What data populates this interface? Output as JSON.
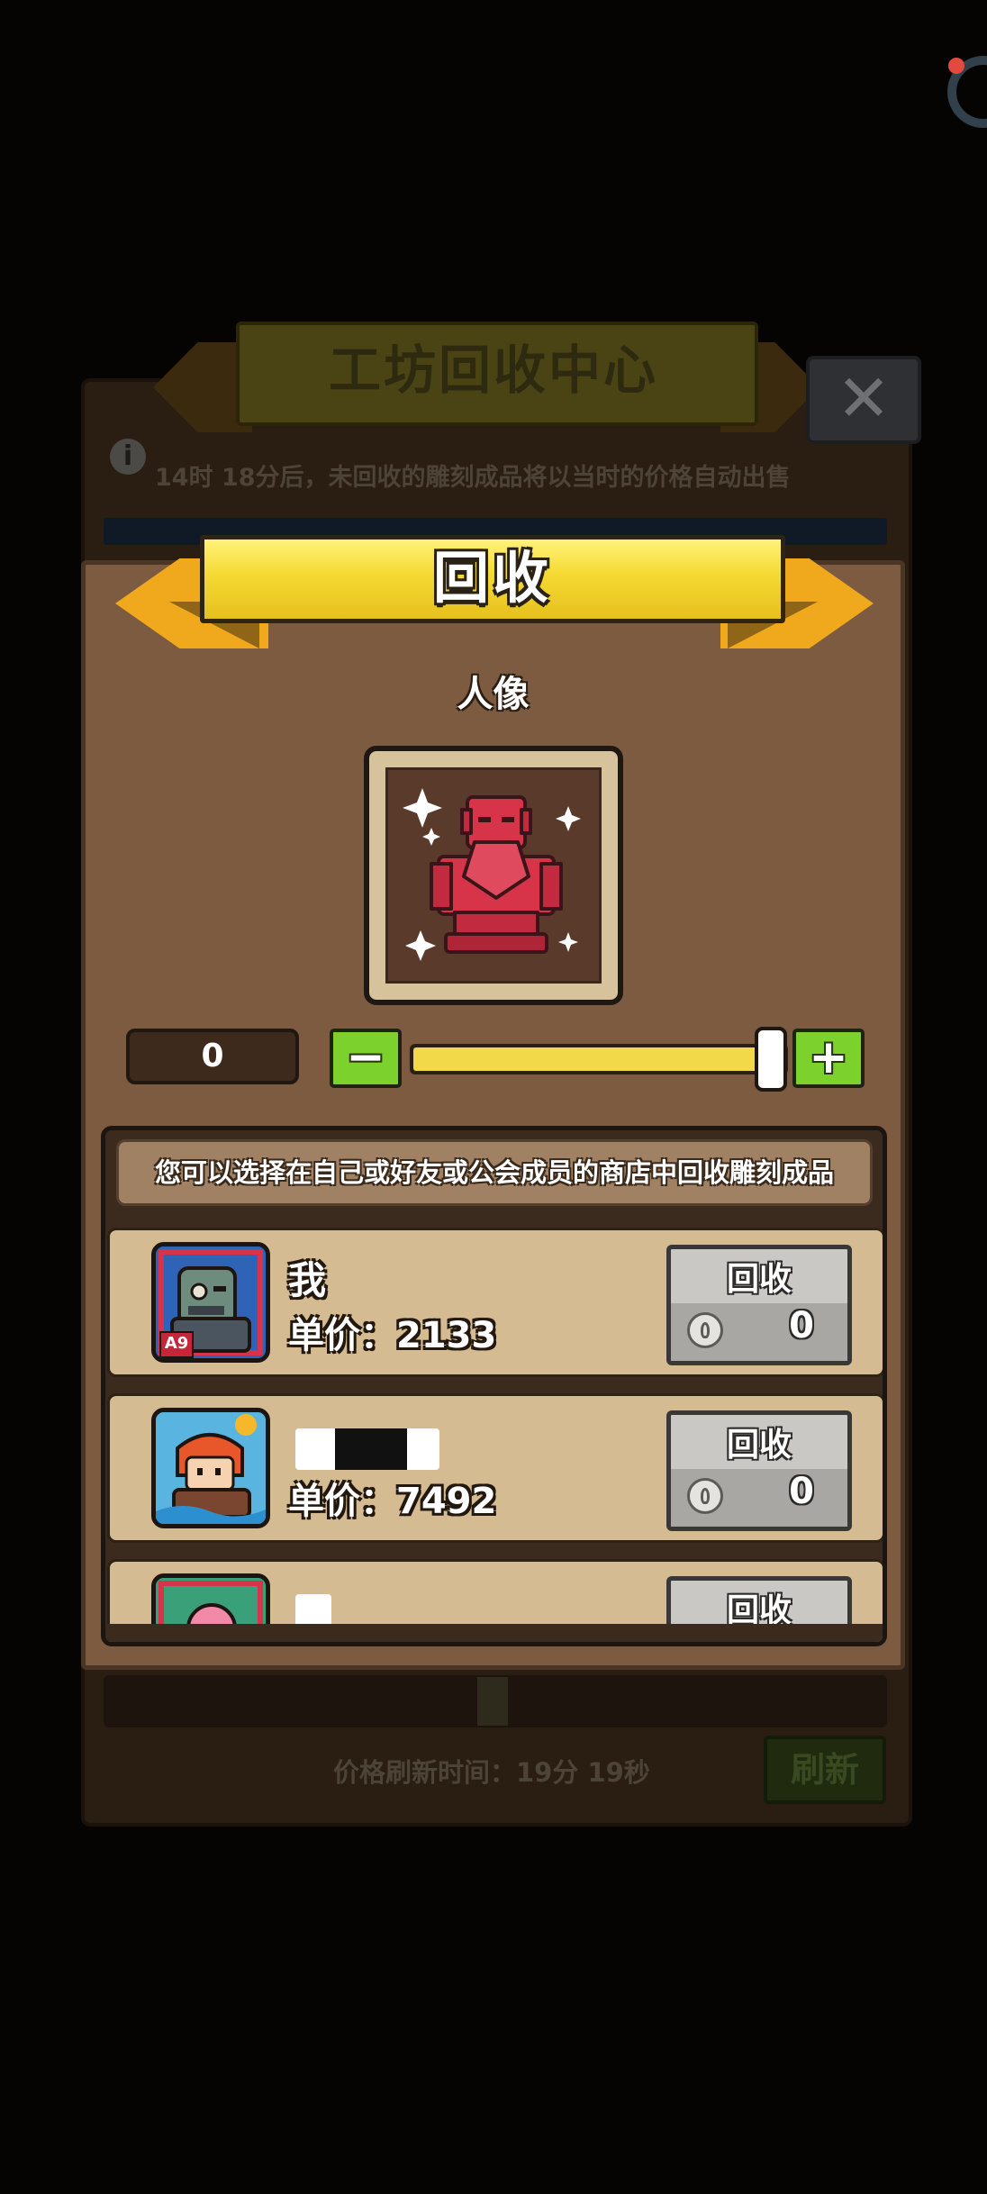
{
  "background": {
    "title": "工坊回收中心",
    "notice": "14时 18分后，未回收的雕刻成品将以当时的价格自动出售",
    "refresh_time": "价格刷新时间：19分 19秒",
    "refresh_button": "刷新",
    "close_glyph": "✕",
    "info_glyph": "i"
  },
  "modal": {
    "title": "回收",
    "item_name": "人像",
    "quantity": "0",
    "minus_glyph": "−",
    "plus_glyph": "+",
    "slider_level": 1.0,
    "hint": "您可以选择在自己或好友或公会成员的商店中回收雕刻成品",
    "rows": [
      {
        "name": "我",
        "price": "单价：2133",
        "badge": "A9",
        "button": "回收",
        "count": "0",
        "avatar_icon": "zombie-portrait-icon"
      },
      {
        "name": "",
        "price": "单价：7492",
        "button": "回收",
        "count": "0",
        "avatar_icon": "red-haired-hero-portrait-icon"
      },
      {
        "name": "",
        "price": "",
        "button": "回收",
        "avatar_icon": "pink-creature-portrait-icon"
      }
    ]
  },
  "colors": {
    "banner_yellow": "#f5d932",
    "ribbon_orange": "#f0a81d",
    "plus_minus_green": "#7cd12c",
    "slider_yellow": "#f1d94a",
    "row_beige": "#d4bb91",
    "statue_red": "#d7344a"
  }
}
